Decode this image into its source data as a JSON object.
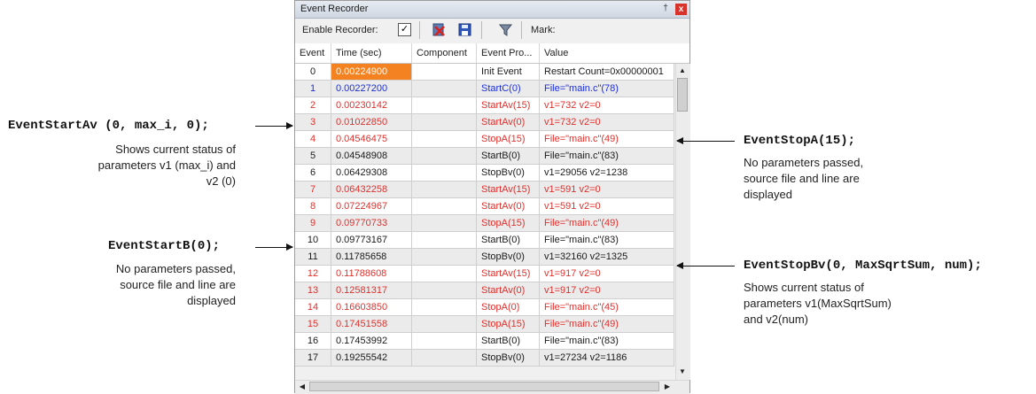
{
  "window": {
    "title": "Event Recorder",
    "pin_glyph": "†",
    "close_glyph": "x"
  },
  "toolbar": {
    "enable_label": "Enable Recorder:",
    "enable_checked": "✓",
    "mark_label": "Mark:"
  },
  "table": {
    "columns": [
      "Event",
      "Time (sec)",
      "Component",
      "Event Pro...",
      "Value"
    ],
    "rows": [
      {
        "event": "0",
        "time": "0.00224900",
        "component": "",
        "property": "Init Event",
        "value": "Restart Count=0x00000001",
        "color": "black"
      },
      {
        "event": "1",
        "time": "0.00227200",
        "component": "",
        "property": "StartC(0)",
        "value": "File=\"main.c\"(78)",
        "color": "blue"
      },
      {
        "event": "2",
        "time": "0.00230142",
        "component": "",
        "property": "StartAv(15)",
        "value": "v1=732 v2=0",
        "color": "red"
      },
      {
        "event": "3",
        "time": "0.01022850",
        "component": "",
        "property": "StartAv(0)",
        "value": "v1=732 v2=0",
        "color": "red"
      },
      {
        "event": "4",
        "time": "0.04546475",
        "component": "",
        "property": "StopA(15)",
        "value": "File=\"main.c\"(49)",
        "color": "red"
      },
      {
        "event": "5",
        "time": "0.04548908",
        "component": "",
        "property": "StartB(0)",
        "value": "File=\"main.c\"(83)",
        "color": "black"
      },
      {
        "event": "6",
        "time": "0.06429308",
        "component": "",
        "property": "StopBv(0)",
        "value": "v1=29056 v2=1238",
        "color": "black"
      },
      {
        "event": "7",
        "time": "0.06432258",
        "component": "",
        "property": "StartAv(15)",
        "value": "v1=591 v2=0",
        "color": "red"
      },
      {
        "event": "8",
        "time": "0.07224967",
        "component": "",
        "property": "StartAv(0)",
        "value": "v1=591 v2=0",
        "color": "red"
      },
      {
        "event": "9",
        "time": "0.09770733",
        "component": "",
        "property": "StopA(15)",
        "value": "File=\"main.c\"(49)",
        "color": "red"
      },
      {
        "event": "10",
        "time": "0.09773167",
        "component": "",
        "property": "StartB(0)",
        "value": "File=\"main.c\"(83)",
        "color": "black"
      },
      {
        "event": "11",
        "time": "0.11785658",
        "component": "",
        "property": "StopBv(0)",
        "value": "v1=32160 v2=1325",
        "color": "black"
      },
      {
        "event": "12",
        "time": "0.11788608",
        "component": "",
        "property": "StartAv(15)",
        "value": "v1=917 v2=0",
        "color": "red"
      },
      {
        "event": "13",
        "time": "0.12581317",
        "component": "",
        "property": "StartAv(0)",
        "value": "v1=917 v2=0",
        "color": "red"
      },
      {
        "event": "14",
        "time": "0.16603850",
        "component": "",
        "property": "StopA(0)",
        "value": "File=\"main.c\"(45)",
        "color": "red"
      },
      {
        "event": "15",
        "time": "0.17451558",
        "component": "",
        "property": "StopA(15)",
        "value": "File=\"main.c\"(49)",
        "color": "red"
      },
      {
        "event": "16",
        "time": "0.17453992",
        "component": "",
        "property": "StartB(0)",
        "value": "File=\"main.c\"(83)",
        "color": "black"
      },
      {
        "event": "17",
        "time": "0.19255542",
        "component": "",
        "property": "StopBv(0)",
        "value": "v1=27234 v2=1186",
        "color": "black"
      }
    ],
    "selected_row": "0"
  },
  "annotations": {
    "start_av": {
      "code": "EventStartAv (0, max_i, 0);",
      "lines": [
        "Shows current status of",
        "parameters v1 (max_i) and",
        "v2 (0)"
      ]
    },
    "start_b": {
      "code": "EventStartB(0);",
      "lines": [
        "No parameters passed,",
        "source file and line are",
        "displayed"
      ]
    },
    "stop_a": {
      "code": "EventStopA(15);",
      "lines": [
        "No parameters passed,",
        "source file and line are",
        "displayed"
      ]
    },
    "stop_bv": {
      "code": "EventStopBv(0, MaxSqrtSum, num);",
      "lines": [
        "Shows current status of",
        "parameters v1(MaxSqrtSum)",
        "and v2(num)"
      ]
    }
  },
  "colors": {
    "red": "#e0302c",
    "blue": "#1c2fd9",
    "selection": "#f58220"
  },
  "icons": {
    "pin": "pin-icon",
    "close": "close-icon",
    "clear": "clear-icon",
    "save": "save-icon",
    "filter": "filter-icon"
  }
}
